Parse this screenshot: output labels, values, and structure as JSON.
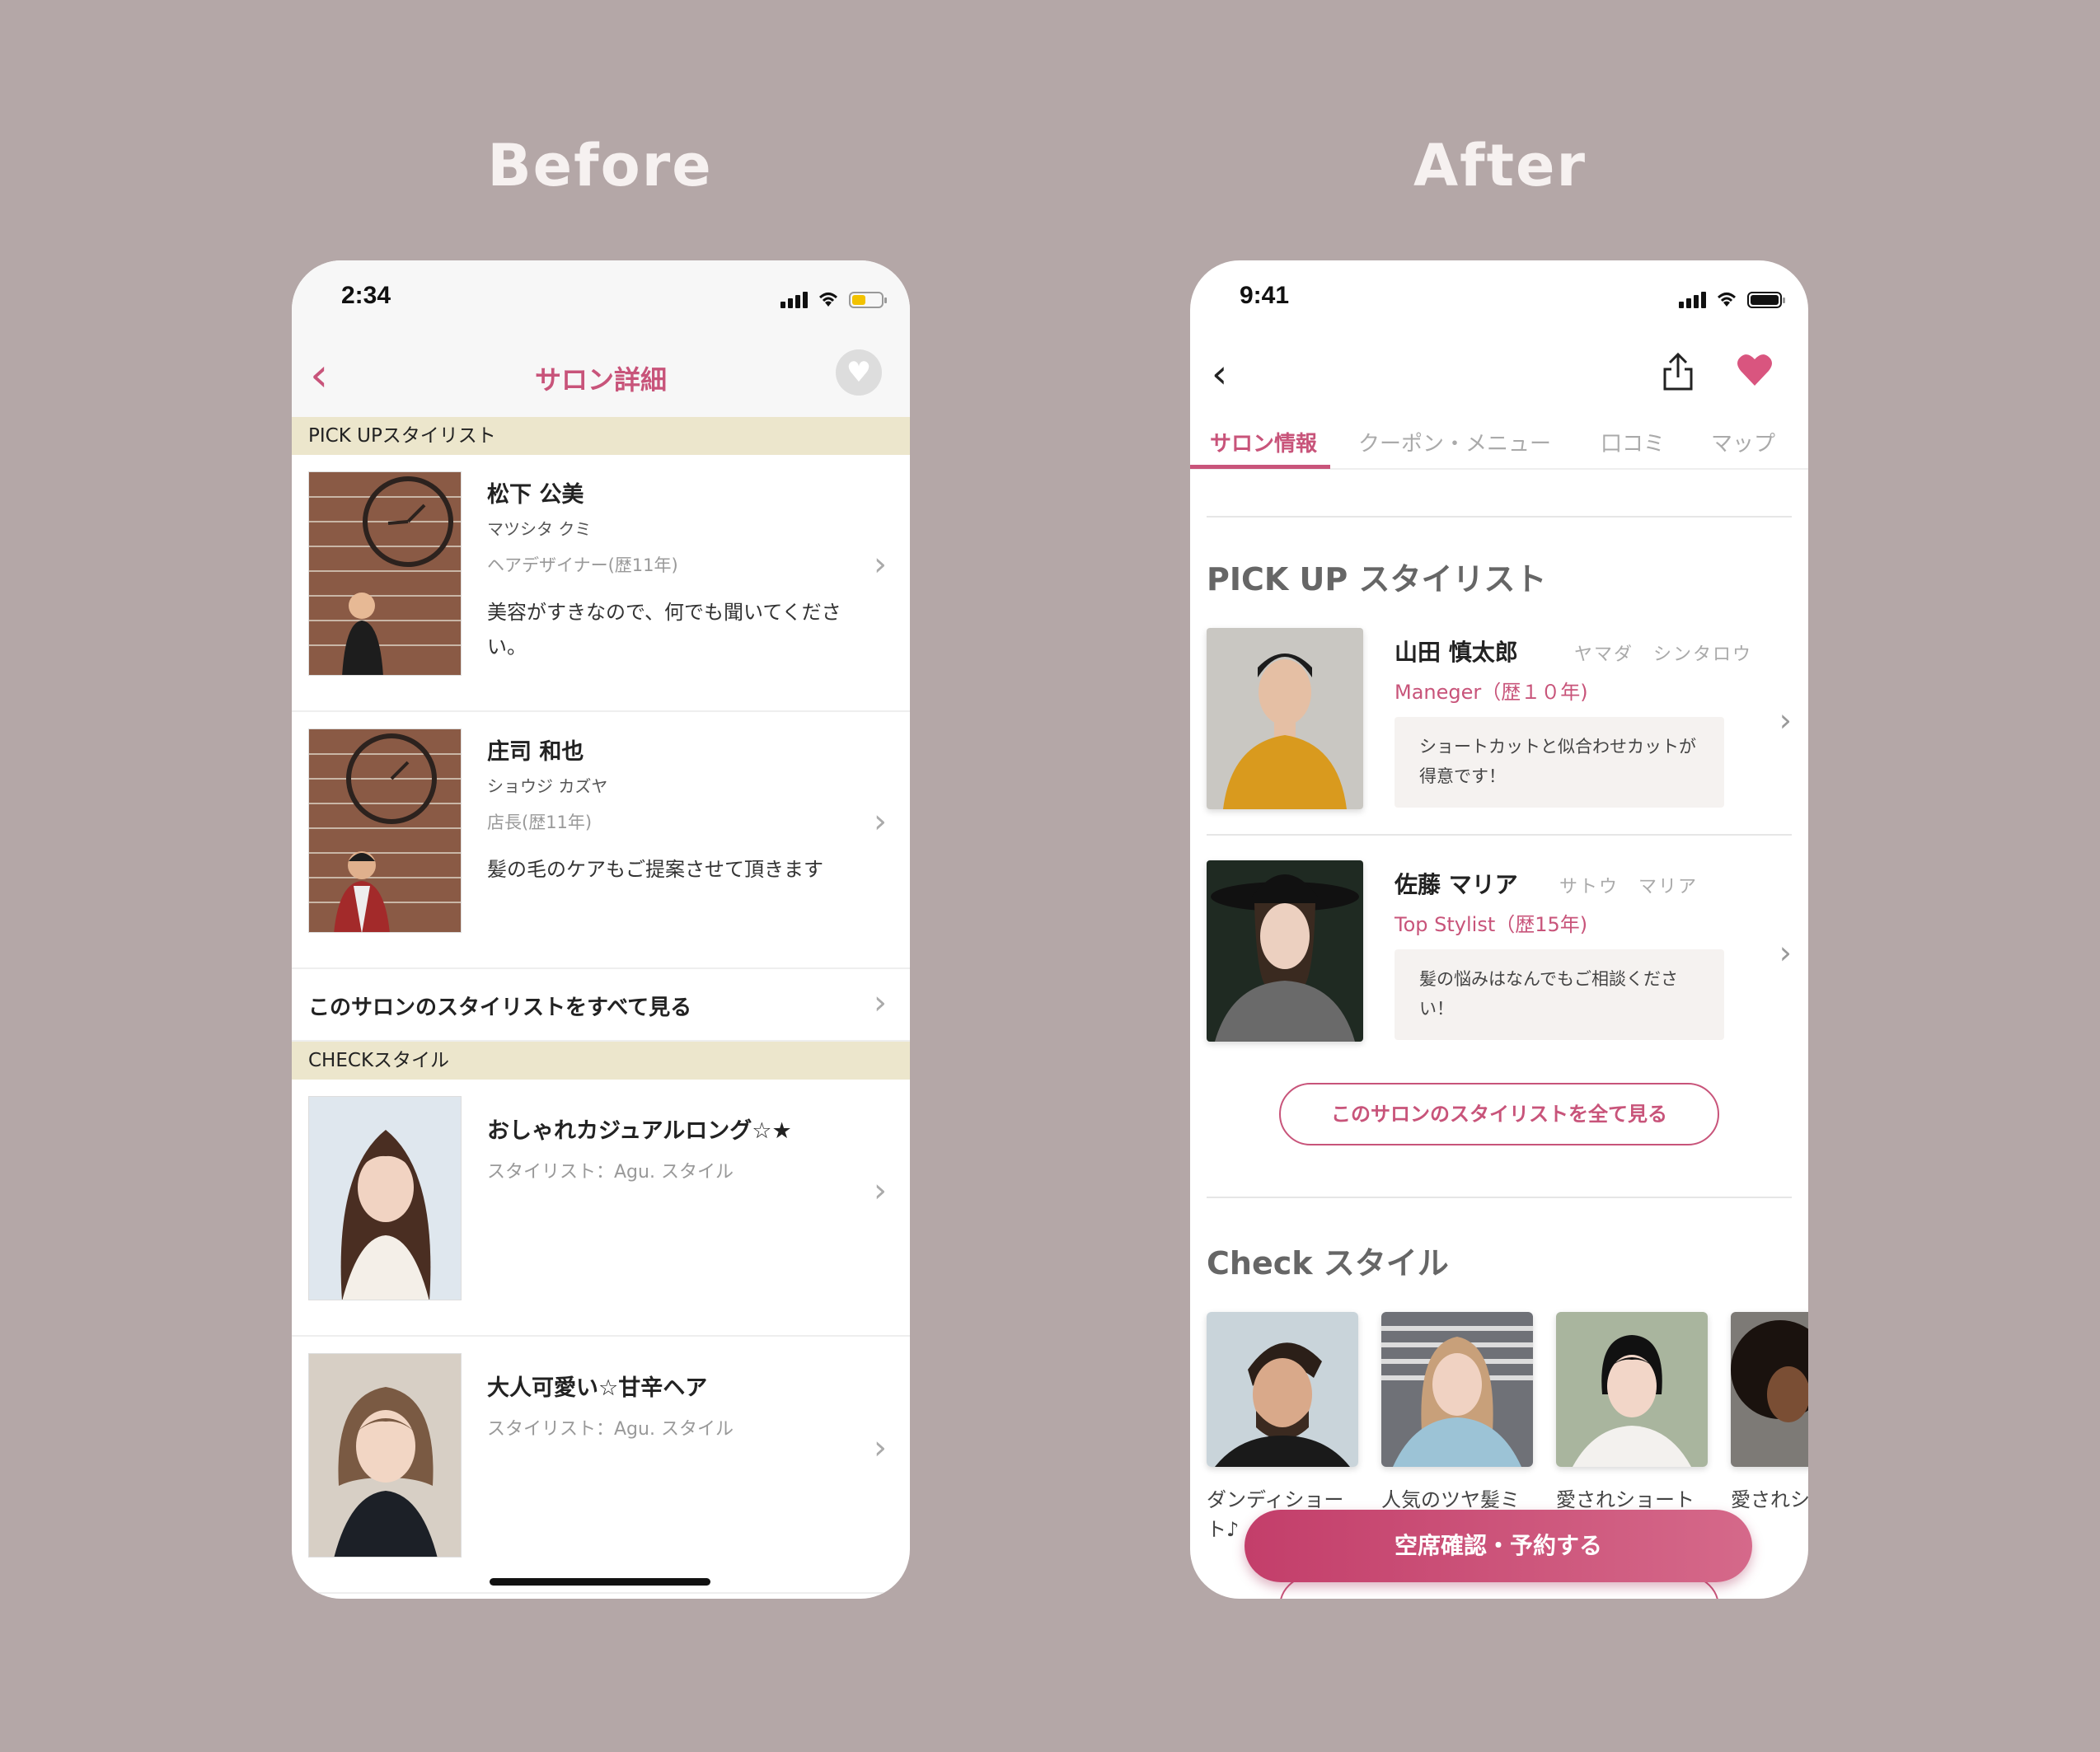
{
  "headings": {
    "before": "Before",
    "after": "After"
  },
  "before": {
    "status": {
      "time": "2:34"
    },
    "nav": {
      "title": "サロン詳細",
      "back_glyph": "‹",
      "favorite_glyph": "♥"
    },
    "pickup_section": "PICK UPスタイリスト",
    "stylists": [
      {
        "name": "松下 公美",
        "kana": "マツシタ クミ",
        "role": "ヘアデザイナー(歴11年)",
        "message": "美容がすきなので、何でも聞いてください。"
      },
      {
        "name": "庄司 和也",
        "kana": "ショウジ カズヤ",
        "role": "店長(歴11年)",
        "message": "髪の毛のケアもご提案させて頂きます"
      }
    ],
    "see_all": "このサロンのスタイリストをすべて見る",
    "check_section": "CHECKスタイル",
    "styles": [
      {
        "title": "おしゃれカジュアルロング☆★",
        "stylist": "スタイリスト：Agu. スタイル"
      },
      {
        "title": "大人可愛い☆甘辛ヘア",
        "stylist": "スタイリスト：Agu. スタイル"
      }
    ],
    "chevron": "›"
  },
  "after": {
    "status": {
      "time": "9:41"
    },
    "nav": {
      "back_glyph": "‹"
    },
    "tabs": [
      "サロン情報",
      "クーポン・メニュー",
      "口コミ",
      "マップ"
    ],
    "pickup_heading": "PICK UP スタイリスト",
    "stylists": [
      {
        "name": "山田 慎太郎",
        "kana": "ヤマダ　シンタロウ",
        "role": "Maneger（歴１０年)",
        "message": "ショートカットと似合わせカットが得意です！"
      },
      {
        "name": "佐藤 マリア",
        "kana": "サトウ　マリア",
        "role": "Top Stylist（歴15年)",
        "message": "髪の悩みはなんでもご相談ください！"
      }
    ],
    "see_all": "このサロンのスタイリストを全て見る",
    "check_heading": "Check スタイル",
    "styles": [
      {
        "caption_line1": "ダンディショー",
        "caption_line2": "ト♪"
      },
      {
        "caption_line1": "人気のツヤ髪ミ",
        "caption_line2": ""
      },
      {
        "caption_line1": "愛されショート",
        "caption_line2": ""
      },
      {
        "caption_line1": "愛されシ",
        "caption_line2": ""
      }
    ],
    "reserve": "空席確認・予約する",
    "chevron": "›"
  },
  "colors": {
    "background": "#b4a7a7",
    "accent": "#c8547a",
    "section_band": "#ece6cc"
  }
}
